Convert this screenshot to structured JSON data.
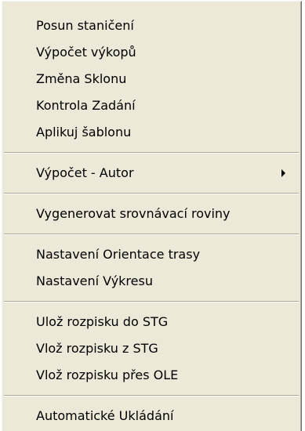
{
  "menu": {
    "groups": [
      {
        "items": [
          {
            "label": "Posun staničení"
          },
          {
            "label": "Výpočet výkopů"
          },
          {
            "label": "Změna Sklonu"
          },
          {
            "label": "Kontrola Zadání"
          },
          {
            "label": "Aplikuj šablonu"
          }
        ]
      },
      {
        "items": [
          {
            "label": "Výpočet - Autor",
            "has_submenu": true,
            "icon": "chevron-right-icon"
          }
        ]
      },
      {
        "items": [
          {
            "label": "Vygenerovat srovnávací roviny"
          }
        ]
      },
      {
        "items": [
          {
            "label": "Nastavení Orientace trasy"
          },
          {
            "label": "Nastavení Výkresu"
          }
        ]
      },
      {
        "items": [
          {
            "label": "Ulož rozpisku do STG"
          },
          {
            "label": "Vlož rozpisku z STG"
          },
          {
            "label": "Vlož rozpisku přes OLE"
          }
        ]
      },
      {
        "items": [
          {
            "label": "Automatické Ukládání"
          }
        ]
      }
    ]
  },
  "colors": {
    "menu_background": "#ece9d8",
    "separator_dark": "#aca899",
    "separator_light": "#ffffff",
    "text": "#000000"
  }
}
